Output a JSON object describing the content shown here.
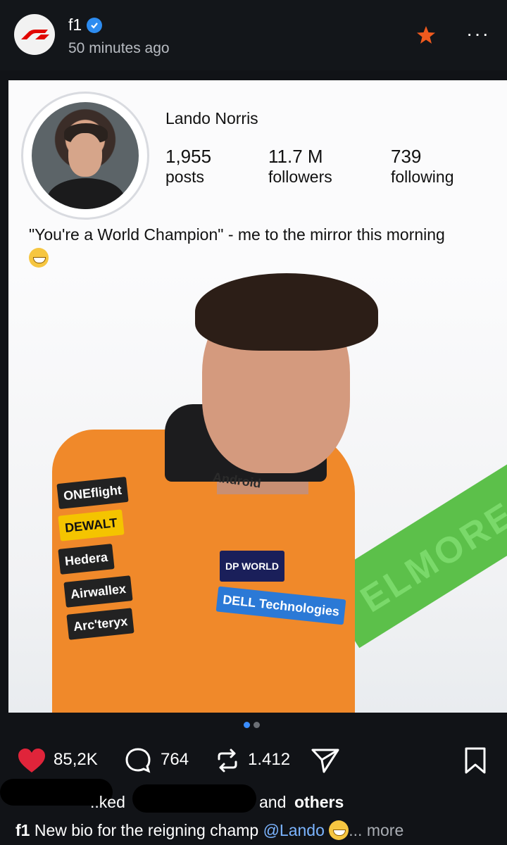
{
  "header": {
    "account_name": "f1",
    "time_ago": "50 minutes ago",
    "more_glyph": "···"
  },
  "post_image": {
    "profile_name": "Lando Norris",
    "stats": [
      {
        "number": "1,955",
        "label": "posts"
      },
      {
        "number": "11.7 M",
        "label": "followers"
      },
      {
        "number": "739",
        "label": "following"
      }
    ],
    "bio_text": "\"You're a World Champion\" - me to the mirror this morning",
    "sponsors": [
      "ONEflight",
      "DEWALT",
      "Hedera",
      "Airwallex",
      "Arc'teryx",
      "Android",
      "DP WORLD",
      "DELL Technologies"
    ],
    "background_text": "ELMORE"
  },
  "carousel": {
    "page": 1,
    "total": 2
  },
  "actions": {
    "likes": "85,2K",
    "comments": "764",
    "reposts": "1.412"
  },
  "liked_by": {
    "partial_text": "..ked",
    "and_text": "and",
    "others_text": "others"
  },
  "caption": {
    "account": "f1",
    "text": "New bio for the reigning champ",
    "mention": "@Lando",
    "more_label": "... more"
  },
  "colors": {
    "background": "#111317",
    "heart": "#e0243a",
    "verified": "#2d8cf0",
    "star": "#f05a1e",
    "mclaren_orange": "#f0892a"
  },
  "icons": [
    "f1-logo-icon",
    "verified-icon",
    "star-icon",
    "more-icon",
    "heart-icon",
    "comment-icon",
    "repost-icon",
    "share-icon",
    "bookmark-icon"
  ]
}
